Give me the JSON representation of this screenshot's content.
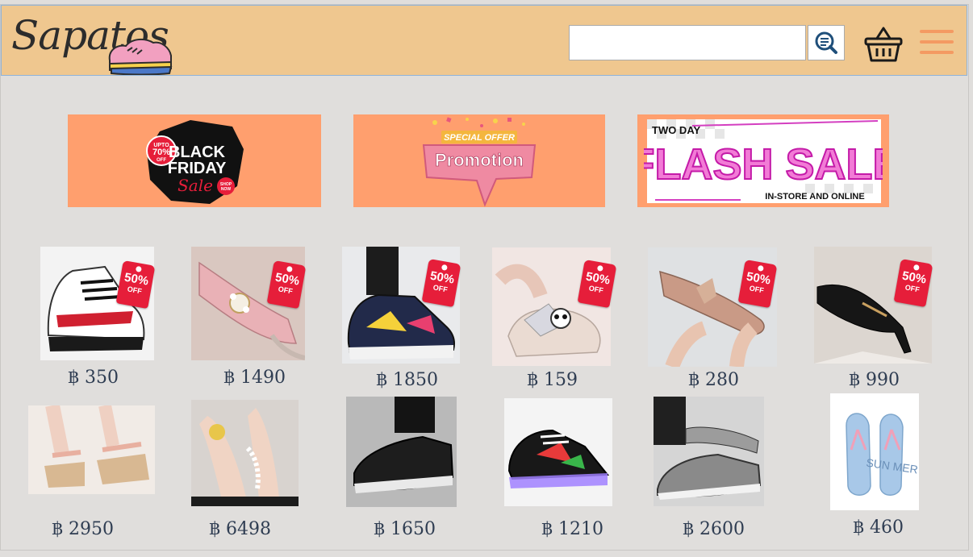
{
  "header": {
    "logo_text": "Sapatos",
    "search": {
      "value": "",
      "placeholder": ""
    },
    "icons": {
      "search": "search-icon",
      "cart": "basket-icon",
      "menu": "hamburger-menu-icon"
    }
  },
  "banners": [
    {
      "name": "black-friday",
      "lines": [
        "UPTO",
        "70%",
        "OFF",
        "BLACK",
        "FRIDAY",
        "Sale",
        "SHOP",
        "NOW"
      ]
    },
    {
      "name": "promotion",
      "lines": [
        "SPECIAL OFFER",
        "Promotion"
      ]
    },
    {
      "name": "flash-sale",
      "lines": [
        "TWO DAY",
        "FLASH SALE",
        "IN-STORE AND ONLINE"
      ]
    }
  ],
  "products": [
    {
      "price": "฿ 350",
      "tag": "50%",
      "tag_off": "OFF",
      "image": "sneaker-red-white"
    },
    {
      "price": "฿ 1490",
      "tag": "50%",
      "tag_off": "OFF",
      "image": "pink-pearl-heel"
    },
    {
      "price": "฿ 1850",
      "tag": "50%",
      "tag_off": "OFF",
      "image": "navy-graffiti-sneaker"
    },
    {
      "price": "฿ 159",
      "tag": "50%",
      "tag_off": "OFF",
      "image": "bow-platform-slipper"
    },
    {
      "price": "฿ 280",
      "tag": "50%",
      "tag_off": "OFF",
      "image": "blush-bow-flat"
    },
    {
      "price": "฿ 990",
      "tag": "50%",
      "tag_off": "OFF",
      "image": "black-pointed-heel"
    },
    {
      "price": "฿ 2950",
      "image": "espadrille-wedge"
    },
    {
      "price": "฿ 6498",
      "image": "pearl-toe-ring-sandal"
    },
    {
      "price": "฿ 1650",
      "image": "black-leather-slipon"
    },
    {
      "price": "฿ 1210",
      "image": "led-light-sneaker"
    },
    {
      "price": "฿ 2600",
      "image": "grey-canvas-loafer"
    },
    {
      "price": "฿ 460",
      "flip_text": "SUN MER",
      "image": "summer-flip-flops"
    }
  ],
  "colors": {
    "header": "#efc78f",
    "banner": "#ff9f6e",
    "menu": "#f49a62",
    "price": "#2f3d52",
    "tag": "#e61e3a",
    "background": "#e0dedc"
  }
}
